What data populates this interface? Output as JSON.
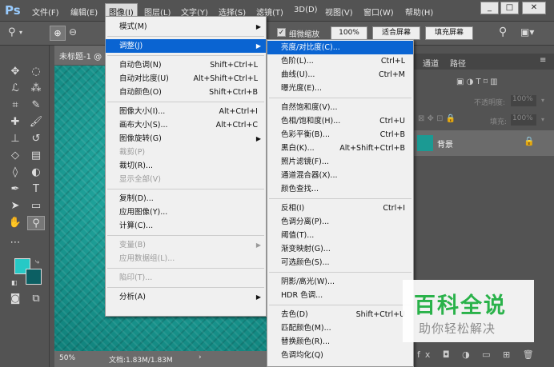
{
  "app": {
    "logo": "Ps"
  },
  "menubar": [
    "文件(F)",
    "编辑(E)",
    "图像(I)",
    "图层(L)",
    "文字(Y)",
    "选择(S)",
    "滤镜(T)",
    "3D(D)",
    "视图(V)",
    "窗口(W)",
    "帮助(H)"
  ],
  "window_buttons": [
    "_",
    "□",
    "✕"
  ],
  "options": {
    "check_label": "细微缩放",
    "zoom": "100%",
    "fit_screen": "适合屏幕",
    "fill_screen": "填充屏幕"
  },
  "doc": {
    "tab_title": "未标题-1 @",
    "status_zoom": "50%",
    "status_doc": "文档:1.83M/1.83M",
    "status_arrow": "›"
  },
  "panels": {
    "tabs": [
      "通道",
      "路径"
    ],
    "opacity_label": "不透明度:",
    "opacity": "100%",
    "fill_label": "填充:",
    "fill": "100%",
    "layer_name": "背景"
  },
  "image_menu": [
    {
      "label": "模式(M)",
      "shortcut": "",
      "submenu": true,
      "disabled": false
    },
    {
      "sep": true
    },
    {
      "label": "调整(J)",
      "shortcut": "",
      "submenu": true,
      "disabled": false,
      "highlight": true
    },
    {
      "sep": true
    },
    {
      "label": "自动色调(N)",
      "shortcut": "Shift+Ctrl+L"
    },
    {
      "label": "自动对比度(U)",
      "shortcut": "Alt+Shift+Ctrl+L"
    },
    {
      "label": "自动颜色(O)",
      "shortcut": "Shift+Ctrl+B"
    },
    {
      "sep": true
    },
    {
      "label": "图像大小(I)...",
      "shortcut": "Alt+Ctrl+I"
    },
    {
      "label": "画布大小(S)...",
      "shortcut": "Alt+Ctrl+C"
    },
    {
      "label": "图像旋转(G)",
      "shortcut": "",
      "submenu": true
    },
    {
      "label": "裁剪(P)",
      "shortcut": "",
      "disabled": true
    },
    {
      "label": "裁切(R)...",
      "shortcut": ""
    },
    {
      "label": "显示全部(V)",
      "shortcut": "",
      "disabled": true
    },
    {
      "sep": true
    },
    {
      "label": "复制(D)...",
      "shortcut": ""
    },
    {
      "label": "应用图像(Y)...",
      "shortcut": ""
    },
    {
      "label": "计算(C)...",
      "shortcut": ""
    },
    {
      "sep": true
    },
    {
      "label": "变量(B)",
      "shortcut": "",
      "submenu": true,
      "disabled": true
    },
    {
      "label": "应用数据组(L)...",
      "shortcut": "",
      "disabled": true
    },
    {
      "sep": true
    },
    {
      "label": "陷印(T)...",
      "shortcut": "",
      "disabled": true
    },
    {
      "sep": true
    },
    {
      "label": "分析(A)",
      "shortcut": "",
      "submenu": true
    }
  ],
  "adjust_menu": [
    {
      "label": "亮度/对比度(C)...",
      "shortcut": "",
      "highlight": true
    },
    {
      "label": "色阶(L)...",
      "shortcut": "Ctrl+L"
    },
    {
      "label": "曲线(U)...",
      "shortcut": "Ctrl+M"
    },
    {
      "label": "曝光度(E)...",
      "shortcut": ""
    },
    {
      "sep": true
    },
    {
      "label": "自然饱和度(V)...",
      "shortcut": ""
    },
    {
      "label": "色相/饱和度(H)...",
      "shortcut": "Ctrl+U"
    },
    {
      "label": "色彩平衡(B)...",
      "shortcut": "Ctrl+B"
    },
    {
      "label": "黑白(K)...",
      "shortcut": "Alt+Shift+Ctrl+B"
    },
    {
      "label": "照片滤镜(F)...",
      "shortcut": ""
    },
    {
      "label": "通道混合器(X)...",
      "shortcut": ""
    },
    {
      "label": "颜色查找...",
      "shortcut": ""
    },
    {
      "sep": true
    },
    {
      "label": "反相(I)",
      "shortcut": "Ctrl+I"
    },
    {
      "label": "色调分离(P)...",
      "shortcut": ""
    },
    {
      "label": "阈值(T)...",
      "shortcut": ""
    },
    {
      "label": "渐变映射(G)...",
      "shortcut": ""
    },
    {
      "label": "可选颜色(S)...",
      "shortcut": ""
    },
    {
      "sep": true
    },
    {
      "label": "阴影/高光(W)...",
      "shortcut": ""
    },
    {
      "label": "HDR 色调...",
      "shortcut": ""
    },
    {
      "sep": true
    },
    {
      "label": "去色(D)",
      "shortcut": "Shift+Ctrl+U"
    },
    {
      "label": "匹配颜色(M)...",
      "shortcut": ""
    },
    {
      "label": "替换颜色(R)...",
      "shortcut": ""
    },
    {
      "label": "色调均化(Q)",
      "shortcut": ""
    }
  ],
  "watermark": {
    "title": "百科全说",
    "subtitle": "助你轻松解决"
  },
  "colors": {
    "foreground": "#27c9c6",
    "background": "#0c5f63",
    "highlight": "#0a64d2",
    "watermark": "#2ab24a"
  }
}
